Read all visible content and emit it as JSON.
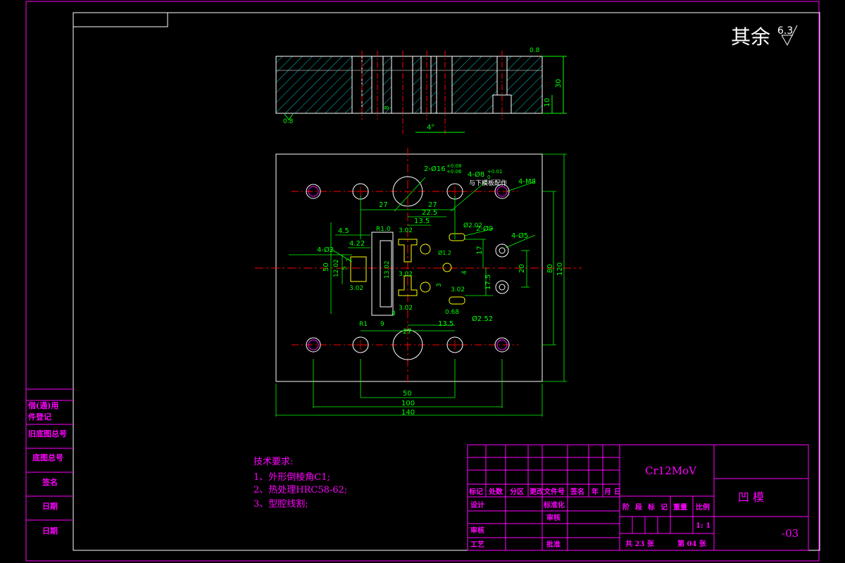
{
  "roughness_note": {
    "text": "其余",
    "value": "6.3"
  },
  "side_view": {
    "roughness_top": "0.8",
    "roughness_bottom": "0.8",
    "dim_thickness": "30",
    "dim_step": "10",
    "dim_left": "8",
    "angle": "4°"
  },
  "plan_view": {
    "callouts": {
      "dowel": "2-Ø16",
      "dowel_tol_upper": "+0.08",
      "dowel_tol_lower": "+0.06",
      "pin": "4-Ø8",
      "pin_tol_upper": "+0.01",
      "pin_tol_lower": "0",
      "pin_note": "与下模板配作",
      "screw": "4-M8",
      "hole9": "2-Ø9",
      "hole5": "4-Ø5",
      "hole2": "4-Ø2",
      "d252": "Ø2.52",
      "d202": "Ø2.02",
      "d12": "Ø1.2"
    },
    "dims": {
      "h27a": "27",
      "h27b": "27",
      "h225": "22.5",
      "h135": "13.5",
      "h45": "4.5",
      "h422": "4.22",
      "h302a": "3.02",
      "h302b": "3.02",
      "h302c": "3.02",
      "h302d": "3.02",
      "h302e": "3.02",
      "r10": "R1.0",
      "r1": "R1",
      "h9": "9",
      "h8": "8",
      "h135b": "13.5",
      "h27c": "27",
      "h068": "0.68",
      "v50": "50",
      "v1202": "12.02",
      "v5": "5",
      "v2": "2",
      "v1302": "13.02",
      "v17": "17",
      "v20": "20",
      "v175": "17.5",
      "v4": "4",
      "v3": "3",
      "v80": "80",
      "v120": "120",
      "b50": "50",
      "b100": "100",
      "b140": "140"
    }
  },
  "left_strip": [
    "借(通)用",
    "件登记",
    "旧底图总号",
    "底图总号",
    "签名",
    "日期",
    "日期"
  ],
  "tech_requirements": {
    "title": "技术要求:",
    "items": [
      "1、外形倒棱角C1;",
      "2、热处理HRC58-62;",
      "3、型腔线割;"
    ]
  },
  "title_block": {
    "material": "Cr12MoV",
    "part_name": "凹  模",
    "drawing_no": "-03",
    "scale_label": "比例",
    "scale": "1: 1",
    "header_row": [
      "标记",
      "处数",
      "分区",
      "更改文件号",
      "签名",
      "年",
      "月",
      "日"
    ],
    "design": "设计",
    "standardize": "标准化",
    "check": "审核",
    "process": "工艺",
    "review": "审核",
    "approve": "批准",
    "stage_labels": [
      "阶",
      "段",
      "标",
      "记"
    ],
    "weight": "重量",
    "total": "共 23 张",
    "sheet": "第 04 张"
  },
  "colors": {
    "border": "#ff00ff",
    "drawing": "#ffffff",
    "center": "#ff0000",
    "dimension": "#00ff00",
    "hatch": "#00c8c8",
    "features": "#ffff00",
    "text": "#ff00ff"
  }
}
